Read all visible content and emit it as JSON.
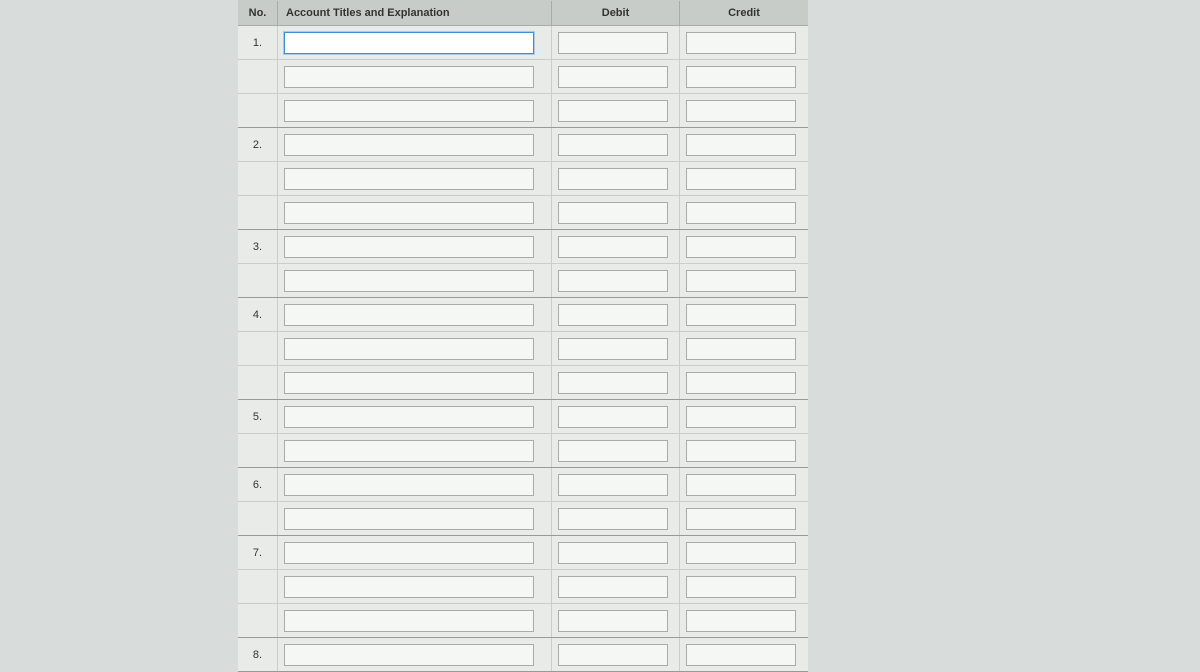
{
  "headers": {
    "no": "No.",
    "account": "Account Titles and Explanation",
    "debit": "Debit",
    "credit": "Credit"
  },
  "entries": [
    {
      "no": "1.",
      "rows": [
        {
          "account": "",
          "debit": "",
          "credit": "",
          "active": true
        },
        {
          "account": "",
          "debit": "",
          "credit": ""
        },
        {
          "account": "",
          "debit": "",
          "credit": ""
        }
      ]
    },
    {
      "no": "2.",
      "rows": [
        {
          "account": "",
          "debit": "",
          "credit": ""
        },
        {
          "account": "",
          "debit": "",
          "credit": ""
        },
        {
          "account": "",
          "debit": "",
          "credit": ""
        }
      ]
    },
    {
      "no": "3.",
      "rows": [
        {
          "account": "",
          "debit": "",
          "credit": ""
        },
        {
          "account": "",
          "debit": "",
          "credit": ""
        }
      ]
    },
    {
      "no": "4.",
      "rows": [
        {
          "account": "",
          "debit": "",
          "credit": ""
        },
        {
          "account": "",
          "debit": "",
          "credit": ""
        },
        {
          "account": "",
          "debit": "",
          "credit": ""
        }
      ]
    },
    {
      "no": "5.",
      "rows": [
        {
          "account": "",
          "debit": "",
          "credit": ""
        },
        {
          "account": "",
          "debit": "",
          "credit": ""
        }
      ]
    },
    {
      "no": "6.",
      "rows": [
        {
          "account": "",
          "debit": "",
          "credit": ""
        },
        {
          "account": "",
          "debit": "",
          "credit": ""
        }
      ]
    },
    {
      "no": "7.",
      "rows": [
        {
          "account": "",
          "debit": "",
          "credit": ""
        },
        {
          "account": "",
          "debit": "",
          "credit": ""
        },
        {
          "account": "",
          "debit": "",
          "credit": ""
        }
      ]
    },
    {
      "no": "8.",
      "rows": [
        {
          "account": "",
          "debit": "",
          "credit": ""
        }
      ]
    }
  ]
}
